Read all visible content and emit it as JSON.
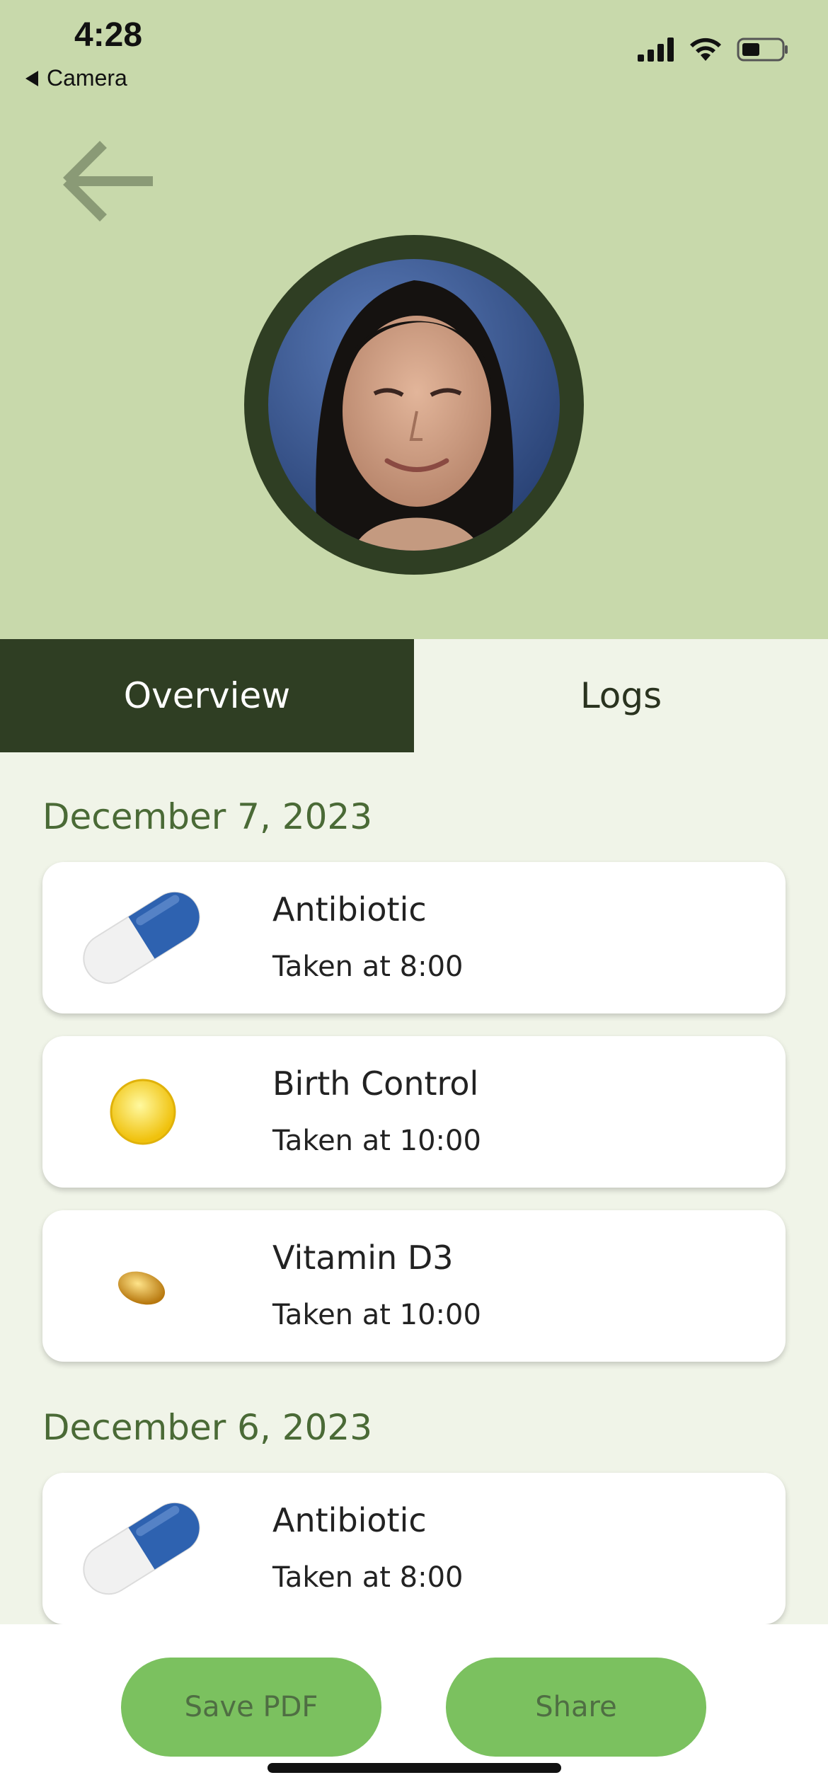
{
  "status_bar": {
    "time": "4:28",
    "back_app": "Camera"
  },
  "tabs": [
    {
      "label": "Overview",
      "active": true
    },
    {
      "label": "Logs",
      "active": false
    }
  ],
  "days": [
    {
      "date": "December 7, 2023",
      "entries": [
        {
          "name": "Antibiotic",
          "time": "Taken at 8:00",
          "icon": "capsule-icon"
        },
        {
          "name": "Birth Control",
          "time": "Taken at 10:00",
          "icon": "yellow-pill-icon"
        },
        {
          "name": "Vitamin D3",
          "time": "Taken at 10:00",
          "icon": "softgel-icon"
        }
      ]
    },
    {
      "date": "December 6, 2023",
      "entries": [
        {
          "name": "Antibiotic",
          "time": "Taken at 8:00",
          "icon": "capsule-icon"
        }
      ]
    }
  ],
  "actions": {
    "save_pdf": "Save PDF",
    "share": "Share"
  },
  "colors": {
    "header_bg": "#c8d9ab",
    "active_tab": "#2f3e23",
    "page_bg": "#f0f4e8",
    "button": "#7bc15f",
    "date_text": "#4a6a36"
  }
}
